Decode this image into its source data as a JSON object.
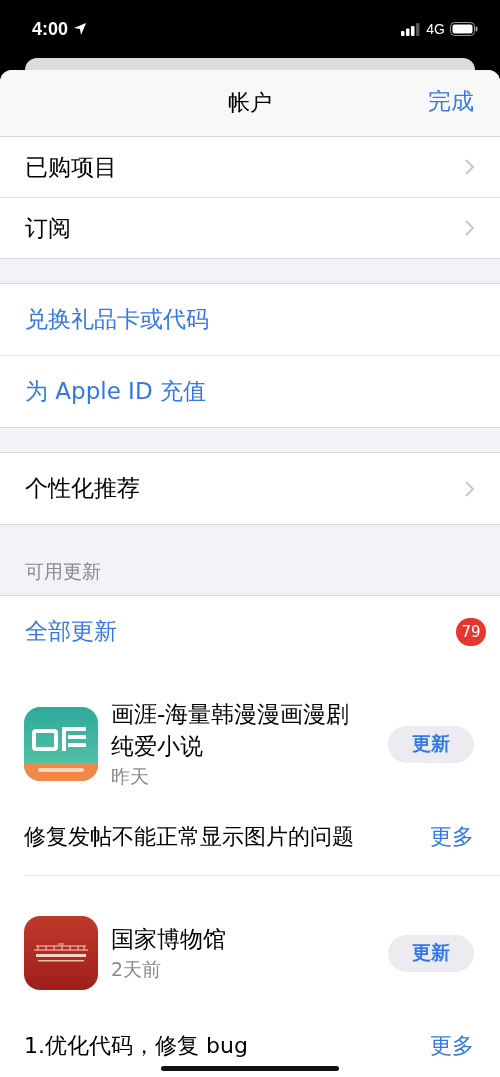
{
  "status_bar": {
    "time": "4:00",
    "network": "4G"
  },
  "header": {
    "title": "帐户",
    "done": "完成"
  },
  "groups": [
    {
      "rows": [
        {
          "label": "已购项目",
          "kind": "nav"
        },
        {
          "label": "订阅",
          "kind": "nav"
        }
      ]
    },
    {
      "rows": [
        {
          "label": "兑换礼品卡或代码",
          "kind": "link"
        },
        {
          "label": "为 Apple ID 充值",
          "kind": "link"
        }
      ]
    },
    {
      "rows": [
        {
          "label": "个性化推荐",
          "kind": "nav"
        }
      ]
    }
  ],
  "updates": {
    "section_title": "可用更新",
    "update_all": "全部更新",
    "badge": "79",
    "apps": [
      {
        "name": "画涯-海量韩漫漫画漫剧纯爱小说",
        "date": "昨天",
        "button": "更新",
        "notes": "修复发帖不能正常显示图片的问题",
        "more": "更多",
        "kind": "comic"
      },
      {
        "name": "国家博物馆",
        "date": "2天前",
        "button": "更新",
        "notes": "1.优化代码，修复 bug",
        "more": "更多",
        "kind": "museum"
      }
    ]
  }
}
